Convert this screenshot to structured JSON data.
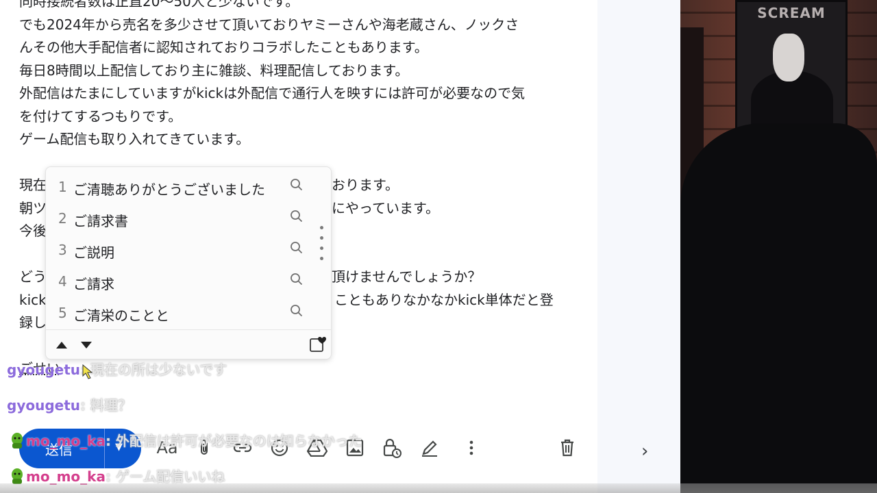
{
  "email_body": {
    "lines": [
      "同時接続者数は正直20〜50人と少ないです。",
      "でも2024年から売名を多少させて頂いておりヤミーさんや海老蔵さん、ノックさ",
      "んその他大手配信者に認知されておりコラボしたこともあります。",
      "毎日8時間以上配信しており主に雑談、料理配信しております。",
      "外配信はたまにしていますがkickは外配信で通行人を映すには許可が必要なので気",
      "を付けてするつもりです。",
      "ゲーム配信も取り入れてきています。",
      "",
      "現在",
      "朝ツ",
      "今後",
      "",
      "どう",
      "kick",
      "録し"
    ],
    "partial_right": {
      "l9": "おります。",
      "l10": "にやっています。",
      "l13": "頂けませんでしょうか？",
      "l14": "こともありなかなかkick単体だと登"
    },
    "composing_text": "ごせい"
  },
  "ime_popup": {
    "candidates": [
      {
        "num": "1",
        "text": "ご清聴ありがとうございました"
      },
      {
        "num": "2",
        "text": "ご請求書"
      },
      {
        "num": "3",
        "text": "ご説明"
      },
      {
        "num": "4",
        "text": "ご請求"
      },
      {
        "num": "5",
        "text": "ご清栄のことと"
      }
    ]
  },
  "toolbar": {
    "send_label": "送信",
    "icons": [
      "format-text-icon",
      "attach-icon",
      "link-icon",
      "emoji-icon",
      "drive-icon",
      "image-icon",
      "confidential-icon",
      "signature-icon",
      "more-icon",
      "delete-icon"
    ],
    "format_label": "Aa"
  },
  "chat_overlay": [
    {
      "user": "gyougetu",
      "message": ": 現在の所は少ないです"
    },
    {
      "user": "gyougetu",
      "message": ": 料理？"
    },
    {
      "user": "mo_mo_ka",
      "message": ": 外配信は許可が必要なのは知らなかった"
    },
    {
      "user": "mo_mo_ka",
      "message": ": ゲーム配信いいね"
    }
  ],
  "webcam": {
    "poster_title": "SCREAM"
  },
  "colors": {
    "send_button": "#0b57d0",
    "chat_user_purple": "#8c6bdc",
    "chat_user_pink": "#d43f8d"
  }
}
